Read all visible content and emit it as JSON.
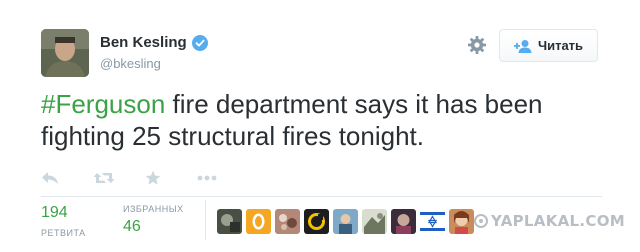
{
  "user": {
    "name": "Ben Kesling",
    "handle": "@bkesling"
  },
  "follow_button": {
    "label": "Читать"
  },
  "tweet": {
    "hashtag": "#Ferguson",
    "text": " fire department says it has been fighting 25 structural fires tonight."
  },
  "actions": [
    "reply-icon",
    "retweet-icon",
    "favorite-icon",
    "more-icon"
  ],
  "stats": {
    "retweets": {
      "count": "194",
      "label": "РЕТВИТА"
    },
    "favorites": {
      "count": "46",
      "label": "ИЗБРАННЫХ"
    }
  },
  "favoriter_avatars": [
    "avatar-1",
    "avatar-2",
    "avatar-3",
    "avatar-4",
    "avatar-5",
    "avatar-6",
    "avatar-7",
    "avatar-8",
    "avatar-9"
  ],
  "watermark": "YAPLAKAL.COM",
  "colors": {
    "hashtag": "#3aa346",
    "verified": "#55acee",
    "muted": "#8899a6",
    "text": "#292f33"
  }
}
